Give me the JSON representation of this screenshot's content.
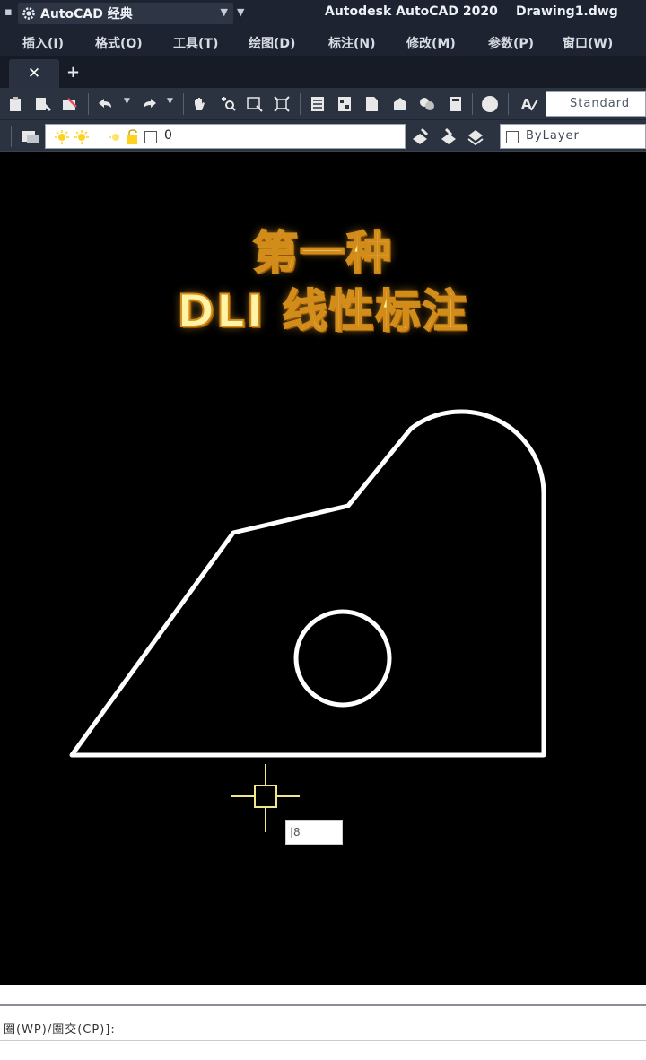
{
  "titlebar": {
    "workspace_label": "AutoCAD 经典",
    "app_title": "Autodesk AutoCAD 2020",
    "document_title": "Drawing1.dwg"
  },
  "menu": {
    "items": [
      "插入(I)",
      "格式(O)",
      "工具(T)",
      "绘图(D)",
      "标注(N)",
      "修改(M)",
      "参数(P)",
      "窗口(W)"
    ]
  },
  "tabs": {
    "close_glyph": "✕",
    "new_glyph": "+"
  },
  "toolbar": {
    "text_style_value": "Standard"
  },
  "layers": {
    "current_layer": "0",
    "color_value": "ByLayer"
  },
  "canvas": {
    "overlay_line1": "第一种",
    "overlay_line2": "DLI 线性标注",
    "dynamic_input_value": "|8"
  },
  "command": {
    "prompt": "圈(WP)/圈交(CP)]:"
  },
  "colors": {
    "background": "#000000",
    "geometry": "#ffffff",
    "cursor": "#f0e68c",
    "titlebar": "#1d2330",
    "toolbar": "#2b3240"
  }
}
